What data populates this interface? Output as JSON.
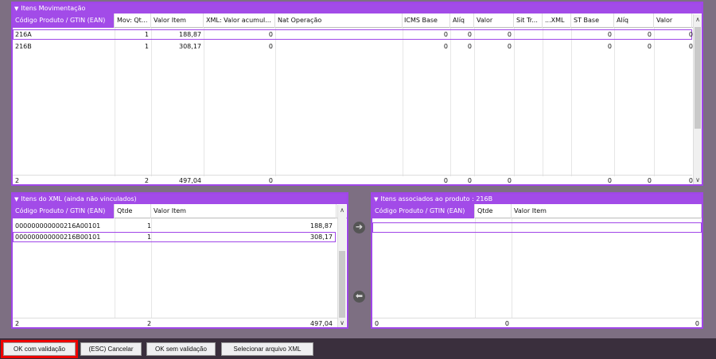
{
  "top_panel": {
    "title": "Itens Movimentação",
    "columns": [
      "Código Produto / GTIN (EAN)",
      "Mov: Qt...",
      "Valor Item",
      "XML: Valor acumul...",
      "Nat Operação",
      "ICMS Base",
      "Alíq",
      "Valor",
      "Sit Tr...",
      "...XML",
      "ST Base",
      "Alíq",
      "Valor"
    ],
    "rows": [
      {
        "code": "216A",
        "qty": "1",
        "valor": "188,87",
        "xml": "0",
        "icms": "0",
        "aliq": "0",
        "val": "0",
        "stbase": "0",
        "staliq": "0",
        "stval": "0"
      },
      {
        "code": "216B",
        "qty": "1",
        "valor": "308,17",
        "xml": "0",
        "icms": "0",
        "aliq": "0",
        "val": "0",
        "stbase": "0",
        "staliq": "0",
        "stval": "0"
      }
    ],
    "footer": {
      "count": "2",
      "qty": "2",
      "valor": "497,04",
      "xml": "0",
      "icms": "0",
      "aliq": "0",
      "val": "0",
      "stbase": "0",
      "staliq": "0",
      "stval": "0"
    }
  },
  "xml_panel": {
    "title": "Itens do XML  (ainda não vinculados)",
    "columns": [
      "Código Produto / GTIN (EAN)",
      "Qtde",
      "Valor Item"
    ],
    "rows": [
      {
        "code": "000000000000216A00101",
        "qty": "1",
        "valor": "188,87"
      },
      {
        "code": "000000000000216B00101",
        "qty": "1",
        "valor": "308,17"
      }
    ],
    "footer": {
      "count": "2",
      "qty": "2",
      "valor": "497,04"
    }
  },
  "assoc_panel": {
    "title": "Itens associados ao produto : 216B",
    "columns": [
      "Código Produto / GTIN (EAN)",
      "Qtde",
      "Valor Item"
    ],
    "footer": {
      "count": "0",
      "qty": "0",
      "valor": "0"
    }
  },
  "buttons": {
    "ok_validacao": "OK com validação",
    "cancelar": "(ESC) Cancelar",
    "ok_sem": "OK sem validação",
    "selecionar": "Selecionar arquivo XML"
  },
  "icons": {
    "arrow_right": "➔",
    "arrow_left": "⬅",
    "collapse": "▼",
    "up": "∧",
    "down": "∨"
  },
  "colors": {
    "accent": "#a24be8",
    "highlight": "#e00000"
  }
}
